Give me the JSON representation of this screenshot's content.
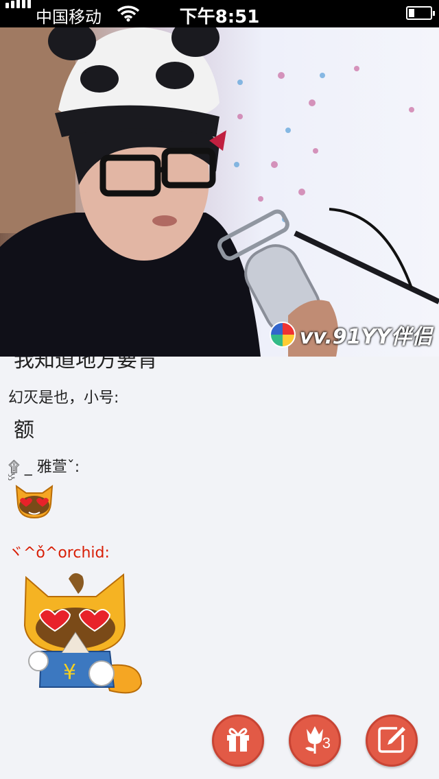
{
  "status_bar": {
    "carrier": "中国移动",
    "time": "下午8:51"
  },
  "video": {
    "watermark": "vv.91YY伴侣"
  },
  "chat": {
    "partial_message": "我知道地方要肯",
    "messages": [
      {
        "sender": "幻灭是也，小号:",
        "text": "额"
      },
      {
        "sender": "ۣۣ۩ _ 雅萱ˇ:",
        "emoji": "love-eyes-cat-icon"
      },
      {
        "sender": "ヾ^ǒ^orchid:",
        "sender_color": "#d81e06",
        "emoji": "love-eyes-cat-dancing-icon"
      }
    ]
  },
  "actions": {
    "gift": {
      "icon": "gift-icon"
    },
    "flower": {
      "icon": "flower-icon",
      "count": "3"
    },
    "compose": {
      "icon": "compose-icon"
    }
  },
  "colors": {
    "accent": "#e25a46",
    "sender_highlight": "#d81e06",
    "background": "#f2f3f7"
  }
}
